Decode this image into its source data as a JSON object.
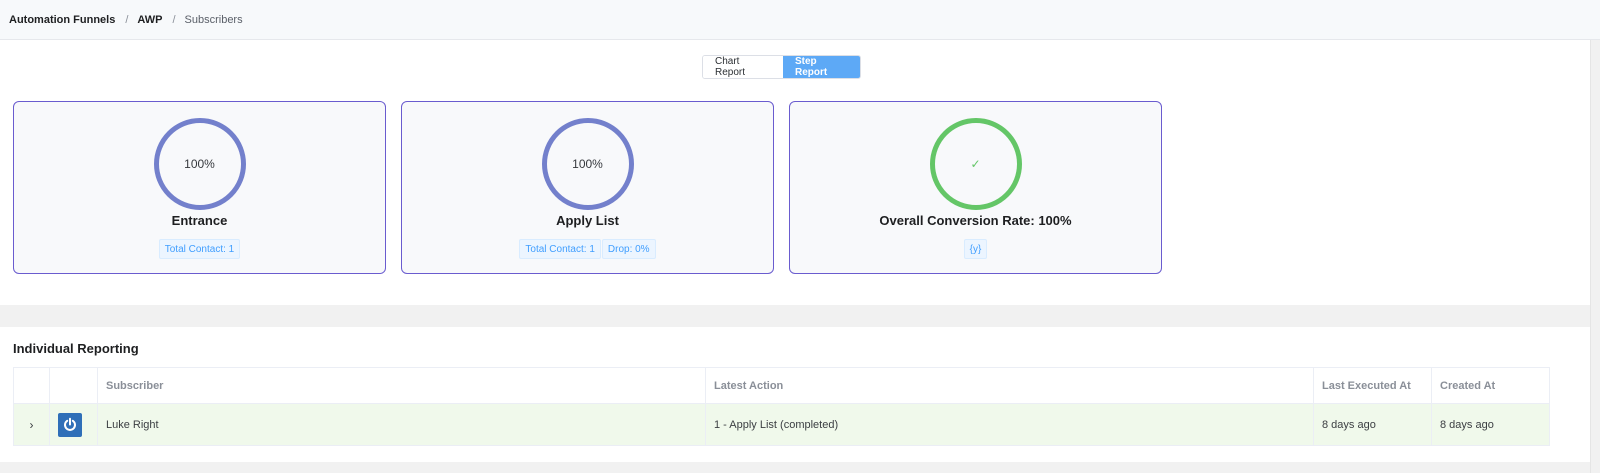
{
  "breadcrumb": {
    "items": [
      "Automation Funnels",
      "AWP",
      "Subscribers"
    ],
    "separator": "/"
  },
  "report_toggle": {
    "chart_label": "Chart Report",
    "step_label": "Step Report",
    "active": "step"
  },
  "cards": [
    {
      "percent": "100%",
      "title": "Entrance",
      "tags": [
        "Total Contact: 1"
      ]
    },
    {
      "percent": "100%",
      "title": "Apply List",
      "tags": [
        "Total Contact: 1",
        "Drop: 0%"
      ]
    },
    {
      "percent": "✓",
      "title": "Overall Conversion Rate: 100%",
      "tags": [
        "{y}"
      ]
    }
  ],
  "individual": {
    "title": "Individual Reporting",
    "columns": [
      "Subscriber",
      "Latest Action",
      "Last Executed At",
      "Created At"
    ],
    "rows": [
      {
        "subscriber": "Luke Right",
        "latest_action": "1 - Apply List (completed)",
        "last_executed": "8 days ago",
        "created": "8 days ago",
        "avatar_icon": "power-icon"
      }
    ]
  },
  "colors": {
    "accent": "#5da9f6",
    "ring_blue": "#7380cc",
    "ring_green": "#64c667",
    "card_border": "#6a5ccf",
    "row_highlight": "#f0f9eb"
  }
}
